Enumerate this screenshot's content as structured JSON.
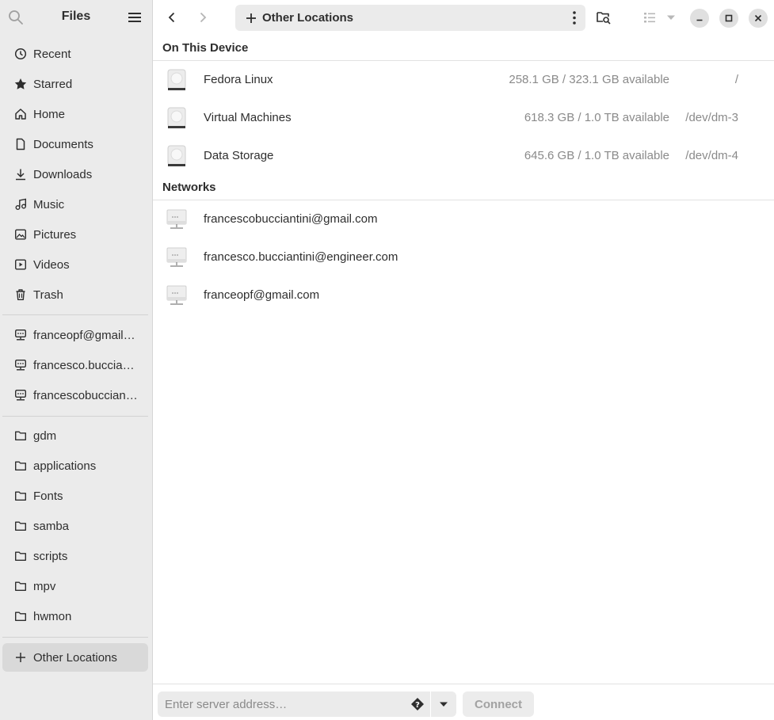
{
  "sidebar": {
    "title": "Files",
    "places": [
      {
        "label": "Recent",
        "icon": "clock-icon"
      },
      {
        "label": "Starred",
        "icon": "star-icon"
      },
      {
        "label": "Home",
        "icon": "home-icon"
      },
      {
        "label": "Documents",
        "icon": "document-icon"
      },
      {
        "label": "Downloads",
        "icon": "download-icon"
      },
      {
        "label": "Music",
        "icon": "music-icon"
      },
      {
        "label": "Pictures",
        "icon": "picture-icon"
      },
      {
        "label": "Videos",
        "icon": "video-icon"
      },
      {
        "label": "Trash",
        "icon": "trash-icon"
      }
    ],
    "network_mounts": [
      {
        "label": "franceopf@gmail.com",
        "icon": "network-icon"
      },
      {
        "label": "francesco.bucciantini@engineer.com",
        "icon": "network-icon"
      },
      {
        "label": "francescobucciantini@gmail.com",
        "icon": "network-icon"
      }
    ],
    "bookmarks": [
      {
        "label": "gdm",
        "icon": "folder-icon"
      },
      {
        "label": "applications",
        "icon": "folder-icon"
      },
      {
        "label": "Fonts",
        "icon": "folder-icon"
      },
      {
        "label": "samba",
        "icon": "folder-icon"
      },
      {
        "label": "scripts",
        "icon": "folder-icon"
      },
      {
        "label": "mpv",
        "icon": "folder-icon"
      },
      {
        "label": "hwmon",
        "icon": "folder-icon"
      }
    ],
    "other_locations": {
      "label": "Other Locations",
      "icon": "plus-icon"
    }
  },
  "toolbar": {
    "location": "Other Locations"
  },
  "main": {
    "on_this_device": {
      "title": "On This Device",
      "items": [
        {
          "name": "Fedora Linux",
          "available": "258.1 GB / 323.1 GB available",
          "mount": "/"
        },
        {
          "name": "Virtual Machines",
          "available": "618.3 GB / 1.0 TB available",
          "mount": "/dev/dm-3"
        },
        {
          "name": "Data Storage",
          "available": "645.6 GB / 1.0 TB available",
          "mount": "/dev/dm-4"
        }
      ]
    },
    "networks": {
      "title": "Networks",
      "items": [
        {
          "name": "francescobucciantini@gmail.com"
        },
        {
          "name": "francesco.bucciantini@engineer.com"
        },
        {
          "name": "franceopf@gmail.com"
        }
      ]
    }
  },
  "bottom_bar": {
    "server_placeholder": "Enter server address…",
    "connect_label": "Connect"
  },
  "colors": {
    "sidebar_bg": "#ebebeb",
    "active_item": "#d9d9d9",
    "text": "#2e2e2e",
    "muted_text": "#8a8a8a"
  }
}
